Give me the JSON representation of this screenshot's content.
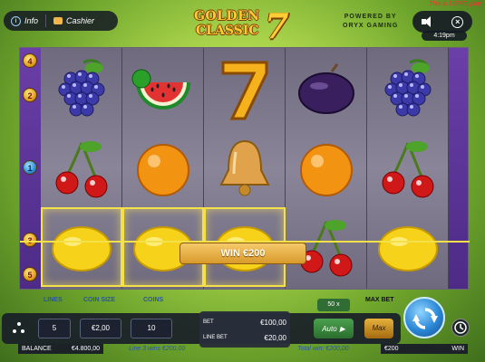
{
  "header": {
    "info_label": "Info",
    "cashier_label": "Cashier",
    "logo_line1": "GOLDEN",
    "logo_line2": "CLASSIC",
    "logo_seven": "7",
    "powered_line1": "POWERED BY",
    "powered_line2": "ORYX GAMING",
    "demo_notice": "This is DEMO play",
    "time": "4:19pm"
  },
  "paylines_left": [
    "4",
    "2",
    "1",
    "3",
    "5"
  ],
  "reels": [
    [
      "grapes",
      "cherries",
      "lemon"
    ],
    [
      "watermelon",
      "orange",
      "lemon"
    ],
    [
      "seven",
      "bell",
      "lemon"
    ],
    [
      "plum",
      "orange",
      "cherries"
    ],
    [
      "grapes",
      "cherries",
      "lemon"
    ]
  ],
  "win_banner": "WIN €200",
  "controls": {
    "lines_label": "LINES",
    "lines_value": "5",
    "coin_size_label": "COIN SIZE",
    "coin_size_value": "€2,00",
    "coins_label": "COINS",
    "coins_value": "10",
    "bet_label": "BET",
    "bet_value": "€100,00",
    "line_bet_label": "LINE BET",
    "line_bet_value": "€20,00",
    "multiplier": "50 x",
    "max_bet_label": "MAX BET",
    "auto_label": "Auto",
    "max_label": "Max"
  },
  "status": {
    "balance_label": "BALANCE",
    "balance_value": "€4.800,00",
    "line_message": "Line 3 wins €200,00",
    "total_message": "Total win: €200,00",
    "win_value": "€200",
    "win_label": "WIN"
  },
  "colors": {
    "accent_gold": "#f4e048",
    "reel_bg": "#8a8598",
    "sidebar_purple": "#5a3396",
    "spin_blue": "#2a86d6"
  }
}
